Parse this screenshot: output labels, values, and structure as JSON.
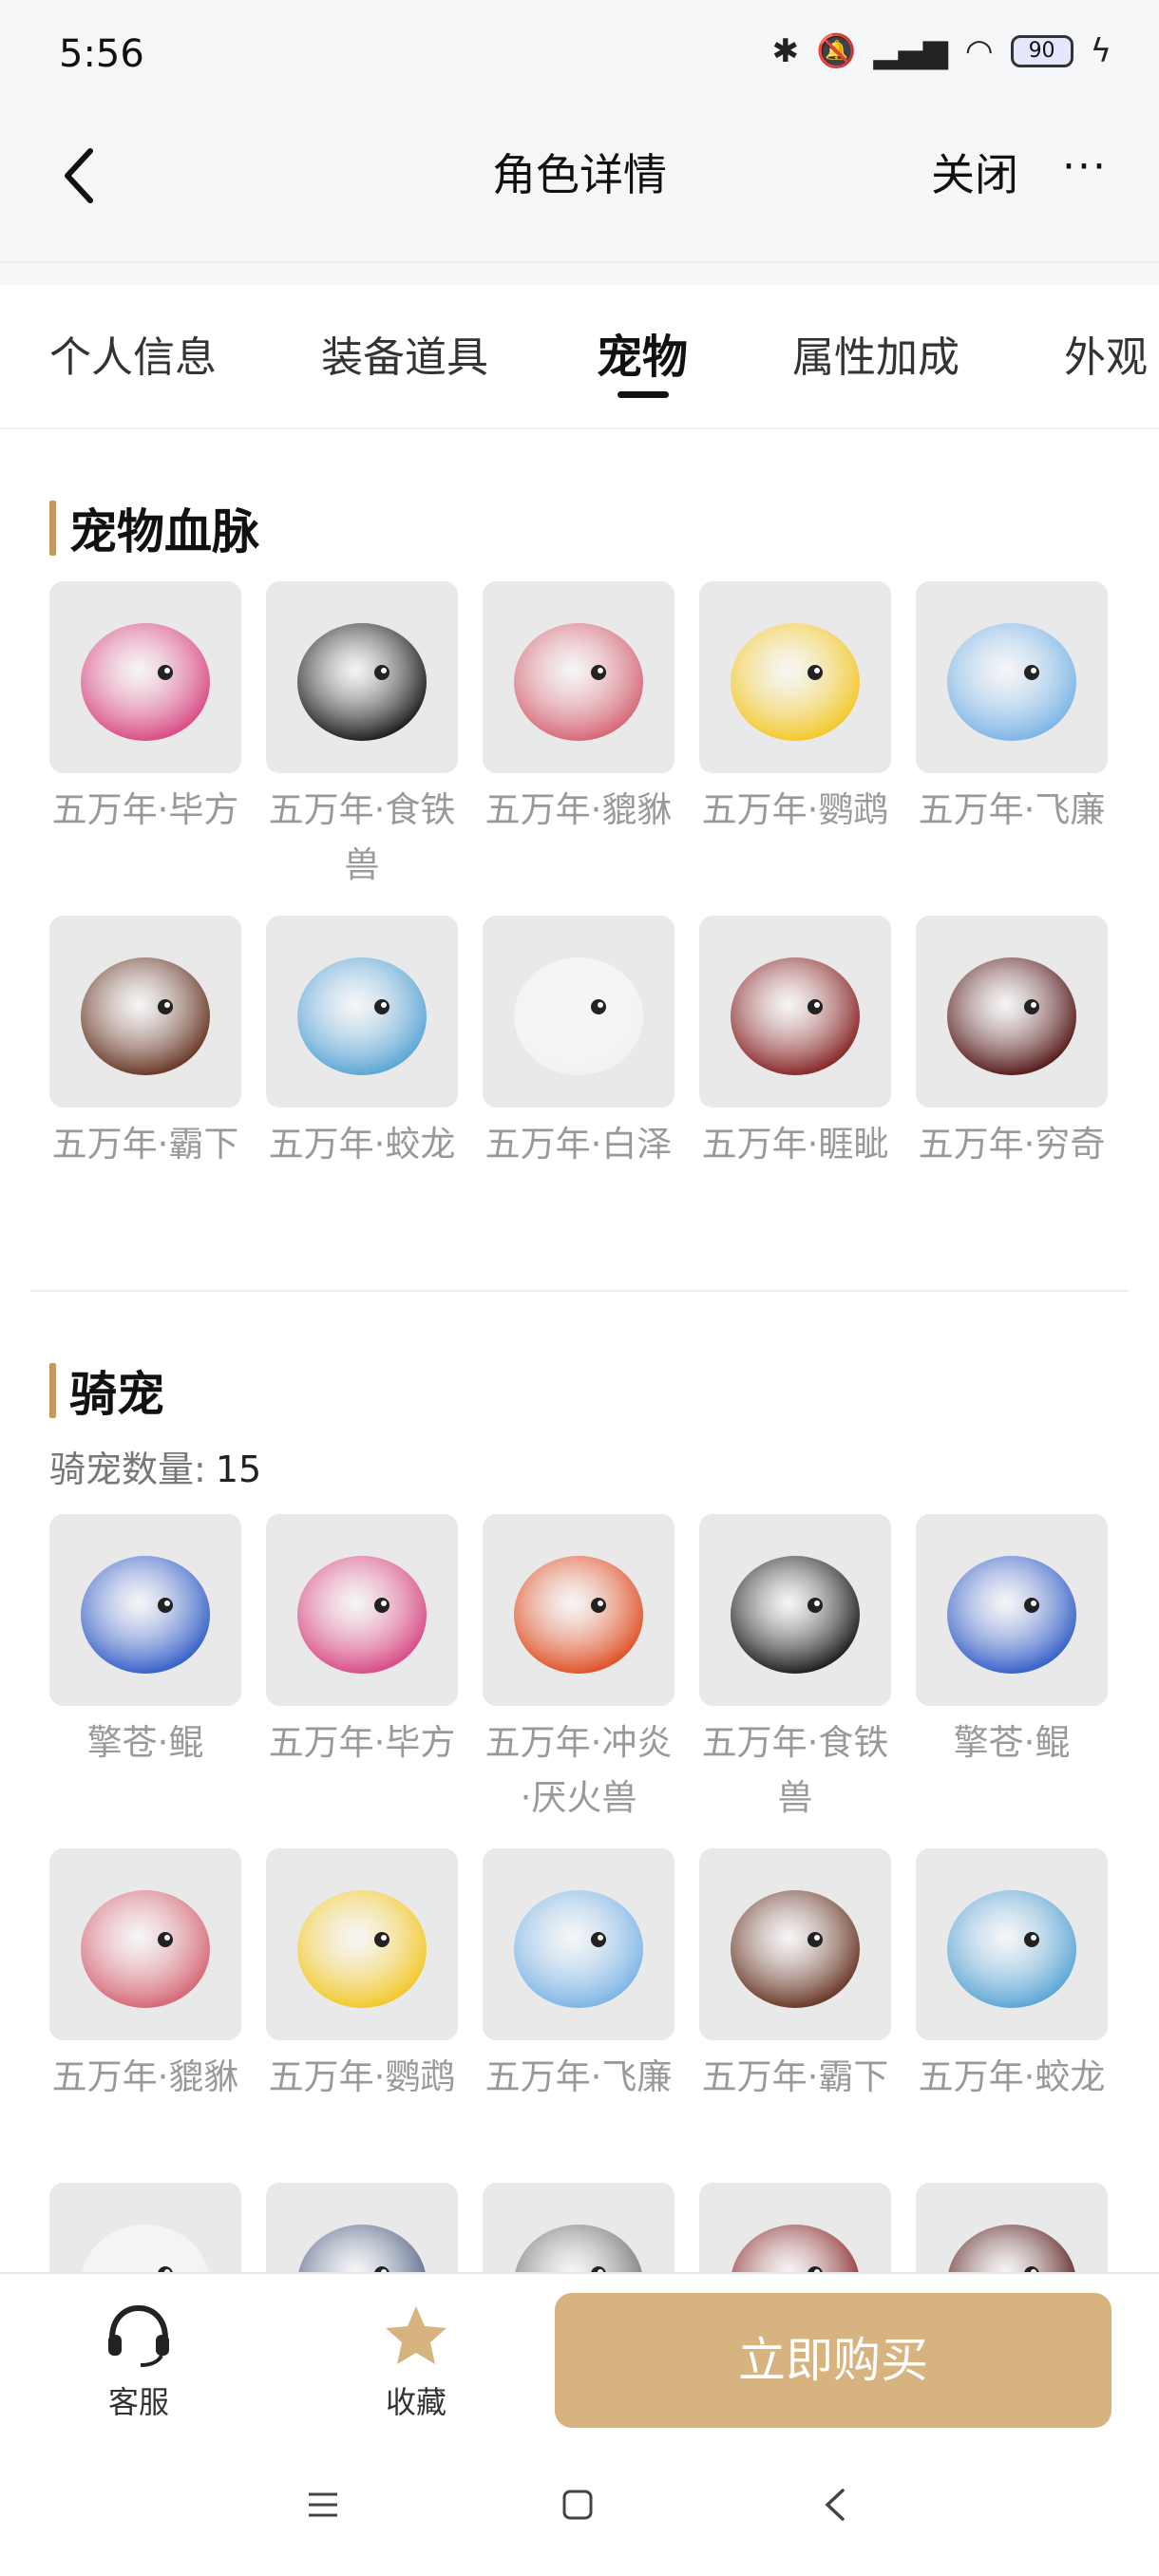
{
  "status": {
    "time": "5:56",
    "battery": "90"
  },
  "header": {
    "title": "角色详情",
    "close_label": "关闭",
    "more_label": "···"
  },
  "tabs": [
    {
      "label": "个人信息"
    },
    {
      "label": "装备道具"
    },
    {
      "label": "宠物"
    },
    {
      "label": "属性加成"
    },
    {
      "label": "外观"
    }
  ],
  "active_tab": "宠物",
  "pet_bloodline": {
    "title": "宠物血脉",
    "items": [
      {
        "label": "五万年·毕方",
        "icon": "bifang-bird-icon",
        "color": "#d94e86"
      },
      {
        "label": "五万年·食铁兽",
        "icon": "panda-icon",
        "color": "#222222"
      },
      {
        "label": "五万年·貔貅",
        "icon": "pixiu-icon",
        "color": "#d66a78"
      },
      {
        "label": "五万年·鹦鹉",
        "icon": "parrot-icon",
        "color": "#f2c92e"
      },
      {
        "label": "五万年·飞廉",
        "icon": "feilian-icon",
        "color": "#7fb6e6"
      },
      {
        "label": "五万年·霸下",
        "icon": "baxia-icon",
        "color": "#6b3b2a"
      },
      {
        "label": "五万年·蛟龙",
        "icon": "jiaolong-icon",
        "color": "#5ea7d6"
      },
      {
        "label": "五万年·白泽",
        "icon": "baize-icon",
        "color": "#f2f2f2"
      },
      {
        "label": "五万年·睚眦",
        "icon": "yazi-icon",
        "color": "#8a2a2a"
      },
      {
        "label": "五万年·穷奇",
        "icon": "qiongqi-icon",
        "color": "#5a1f1f"
      }
    ]
  },
  "mounts": {
    "title": "骑宠",
    "count_label": "骑宠数量:",
    "count": "15",
    "items": [
      {
        "label": "擎苍·鲲",
        "icon": "kun-icon",
        "color": "#3a63c9"
      },
      {
        "label": "五万年·毕方",
        "icon": "bifang-bird-icon",
        "color": "#d94e86"
      },
      {
        "label": "五万年·冲炎·厌火兽",
        "icon": "fire-beast-icon",
        "color": "#e0542a"
      },
      {
        "label": "五万年·食铁兽",
        "icon": "panda-icon",
        "color": "#222222"
      },
      {
        "label": "擎苍·鲲",
        "icon": "kun-icon",
        "color": "#3a63c9"
      },
      {
        "label": "五万年·貔貅",
        "icon": "pixiu-icon",
        "color": "#d66a78"
      },
      {
        "label": "五万年·鹦鹉",
        "icon": "parrot-icon",
        "color": "#f2c92e"
      },
      {
        "label": "五万年·飞廉",
        "icon": "feilian-icon",
        "color": "#7fb6e6"
      },
      {
        "label": "五万年·霸下",
        "icon": "baxia-icon",
        "color": "#6b3b2a"
      },
      {
        "label": "五万年·蛟龙",
        "icon": "jiaolong-icon",
        "color": "#5ea7d6"
      },
      {
        "label": "",
        "icon": "baize-icon",
        "color": "#f2f2f2"
      },
      {
        "label": "",
        "icon": "crown-icon",
        "color": "#556688"
      },
      {
        "label": "",
        "icon": "gray-beast-icon",
        "color": "#777777"
      },
      {
        "label": "",
        "icon": "yazi-icon",
        "color": "#8a2a2a"
      },
      {
        "label": "",
        "icon": "qiongqi-icon",
        "color": "#5a1f1f"
      }
    ]
  },
  "bottom": {
    "service_label": "客服",
    "favorite_label": "收藏",
    "buy_label": "立即购买",
    "accent": "#d6b37f"
  }
}
